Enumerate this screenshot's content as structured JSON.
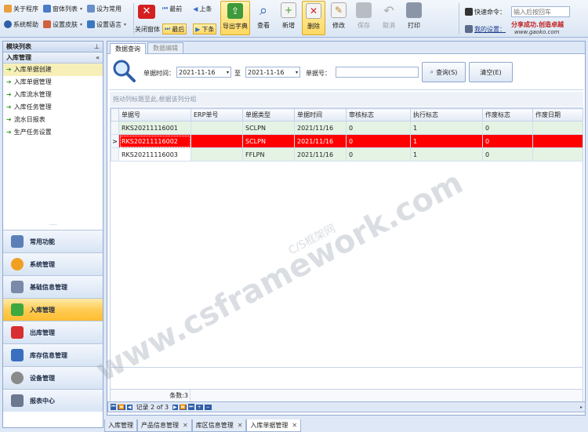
{
  "toolbar": {
    "about": "关于程序",
    "window_list": "窗体列表",
    "set_common": "设为常用",
    "help": "系统帮助",
    "skin": "设置皮肤",
    "language": "设置语言",
    "close_window": "关闭窗体",
    "first": "最前",
    "prev": "上条",
    "last": "最后",
    "next": "下条",
    "export": "导出字典",
    "view": "查看",
    "add": "新增",
    "delete": "删除",
    "edit": "修改",
    "save": "保存",
    "cancel": "取消",
    "print": "打印",
    "quick_cmd_label": "快速命令：",
    "quick_cmd_placeholder": "输入后按回车",
    "my_settings": "我的设置：",
    "slogan": "分享成功.创造卓越",
    "site": "www.gaoko.com"
  },
  "nav": {
    "panel_title": "模块列表",
    "group_title": "入库管理",
    "items": [
      {
        "label": "入库单据创建"
      },
      {
        "label": "入库单据管理"
      },
      {
        "label": "入库流水管理"
      },
      {
        "label": "入库任务管理"
      },
      {
        "label": "流水日报表"
      },
      {
        "label": "生产任务设置"
      }
    ],
    "modules": [
      {
        "label": "常用功能",
        "color": "#5b7fb8"
      },
      {
        "label": "系统管理",
        "color": "#f0a020"
      },
      {
        "label": "基础信息管理",
        "color": "#7a8aa8"
      },
      {
        "label": "入库管理",
        "color": "#3ea840"
      },
      {
        "label": "出库管理",
        "color": "#d83030"
      },
      {
        "label": "库存信息管理",
        "color": "#3a6fc0"
      },
      {
        "label": "设备管理",
        "color": "#8a8a8a"
      },
      {
        "label": "报表中心",
        "color": "#6a7890"
      }
    ]
  },
  "main": {
    "tabs": [
      {
        "label": "数据查询"
      },
      {
        "label": "数据编辑"
      }
    ],
    "filter": {
      "date_label": "单据时间：",
      "date_from": "2021-11-16",
      "to_label": "至",
      "date_to": "2021-11-16",
      "doc_no_label": "单据号：",
      "doc_no_value": "",
      "query_button": "查询(S)",
      "clear_button": "清空(E)"
    },
    "group_hint": "拖动列标题至此,根据该列分组",
    "columns": [
      "单据号",
      "ERP单号",
      "单据类型",
      "单据时间",
      "审核标志",
      "执行标志",
      "作废标志",
      "作废日期"
    ],
    "rows": [
      {
        "indicator": "",
        "cells": [
          "RKS20211116001",
          "",
          "SCLPN",
          "2021/11/16",
          "0",
          "1",
          "0",
          ""
        ]
      },
      {
        "indicator": ">",
        "cells": [
          "RKS20211116002",
          "",
          "SCLPN",
          "2021/11/16",
          "0",
          "1",
          "0",
          ""
        ]
      },
      {
        "indicator": "",
        "cells": [
          "RKS20211116003",
          "",
          "FFLPN",
          "2021/11/16",
          "0",
          "1",
          "0",
          ""
        ]
      }
    ],
    "count_label": "条数:3",
    "record_label": "记录 2 of 3"
  },
  "doc_tabs": [
    {
      "label": "入库管理",
      "closable": false
    },
    {
      "label": "产品信息管理",
      "closable": true
    },
    {
      "label": "库区信息管理",
      "closable": true
    },
    {
      "label": "入库单据管理",
      "closable": true
    }
  ],
  "watermark": {
    "main": "www.csframework.com",
    "sub": "C/S框架网"
  }
}
